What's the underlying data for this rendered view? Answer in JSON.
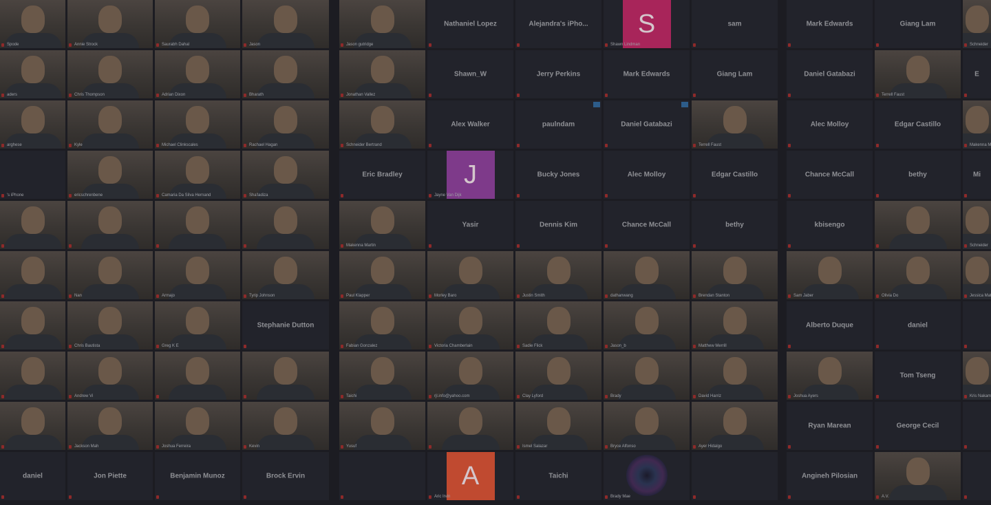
{
  "panels": [
    {
      "id": "left",
      "cols": 4,
      "tiles": [
        {
          "t": "video",
          "cap": "Spode"
        },
        {
          "t": "video",
          "cap": "Annie Strock"
        },
        {
          "t": "video",
          "cap": "Saurabh Dahal"
        },
        {
          "t": "video",
          "cap": "Jason"
        },
        {
          "t": "video",
          "cap": "aders"
        },
        {
          "t": "video",
          "cap": "Chris Thompson"
        },
        {
          "t": "video",
          "cap": "Adrian Dixon"
        },
        {
          "t": "video",
          "cap": "Bharath"
        },
        {
          "t": "video",
          "cap": "arghese"
        },
        {
          "t": "video",
          "cap": "Kyle"
        },
        {
          "t": "video",
          "cap": "Michael Clinkscales"
        },
        {
          "t": "video",
          "cap": "Rachael Hagan"
        },
        {
          "t": "name",
          "label": "",
          "cap": "'s iPhone"
        },
        {
          "t": "video",
          "cap": "ericschrenbene"
        },
        {
          "t": "video",
          "cap": "Camaria Da Silva Hernand"
        },
        {
          "t": "video",
          "cap": "Sha'ladiza"
        },
        {
          "t": "video",
          "cap": ""
        },
        {
          "t": "video",
          "cap": ""
        },
        {
          "t": "video",
          "cap": ""
        },
        {
          "t": "video",
          "cap": ""
        },
        {
          "t": "video",
          "cap": ""
        },
        {
          "t": "video",
          "cap": "Nan"
        },
        {
          "t": "video",
          "cap": "Armajo"
        },
        {
          "t": "video",
          "cap": "Tyrip Johnson"
        },
        {
          "t": "video",
          "cap": ""
        },
        {
          "t": "video",
          "cap": "Chris Bautista"
        },
        {
          "t": "video",
          "cap": "Greg K E"
        },
        {
          "t": "name",
          "label": "Stephanie Dutton",
          "cap": ""
        },
        {
          "t": "video",
          "cap": ""
        },
        {
          "t": "video",
          "cap": "Andrew Vi"
        },
        {
          "t": "video",
          "cap": ""
        },
        {
          "t": "video",
          "cap": ""
        },
        {
          "t": "video",
          "cap": ""
        },
        {
          "t": "video",
          "cap": "Jackson Mah"
        },
        {
          "t": "video",
          "cap": "Joshua Ferreira"
        },
        {
          "t": "video",
          "cap": "Kevin"
        },
        {
          "t": "name",
          "label": "daniel",
          "cap": ""
        },
        {
          "t": "name",
          "label": "Jon Piette",
          "cap": ""
        },
        {
          "t": "name",
          "label": "Benjamin Munoz",
          "cap": ""
        },
        {
          "t": "name",
          "label": "Brock Ervin",
          "cap": ""
        }
      ]
    },
    {
      "id": "middle",
      "cols": 5,
      "tiles": [
        {
          "t": "video",
          "cap": "Jason gutridge"
        },
        {
          "t": "name",
          "label": "Nathaniel Lopez",
          "cap": ""
        },
        {
          "t": "name",
          "label": "Alejandra's  iPho...",
          "cap": ""
        },
        {
          "t": "avatar",
          "letter": "S",
          "color": "#a8255a",
          "cap": "Shawn Lindman"
        },
        {
          "t": "name",
          "label": "sam",
          "cap": ""
        },
        {
          "t": "video",
          "cap": "Jonathan Vallez"
        },
        {
          "t": "name",
          "label": "Shawn_W",
          "cap": ""
        },
        {
          "t": "name",
          "label": "Jerry Perkins",
          "cap": ""
        },
        {
          "t": "name",
          "label": "Mark Edwards",
          "cap": ""
        },
        {
          "t": "name",
          "label": "Giang Lam",
          "cap": ""
        },
        {
          "t": "video",
          "cap": "Schneider Bertrand"
        },
        {
          "t": "name",
          "label": "Alex Walker",
          "cap": ""
        },
        {
          "t": "name",
          "label": "paulndam",
          "cap": "",
          "badge": true
        },
        {
          "t": "name",
          "label": "Daniel Gatabazi",
          "cap": "",
          "badge": true
        },
        {
          "t": "video",
          "cap": "Terrell Faust"
        },
        {
          "t": "name",
          "label": "Eric Bradley",
          "cap": ""
        },
        {
          "t": "avatar",
          "letter": "J",
          "color": "#7e3a8a",
          "cap": "Jayne Van Dijk"
        },
        {
          "t": "name",
          "label": "Bucky Jones",
          "cap": ""
        },
        {
          "t": "name",
          "label": "Alec Molloy",
          "cap": ""
        },
        {
          "t": "name",
          "label": "Edgar Castillo",
          "cap": ""
        },
        {
          "t": "video",
          "cap": "Makenna Martin"
        },
        {
          "t": "name",
          "label": "Yasir",
          "cap": ""
        },
        {
          "t": "name",
          "label": "Dennis Kim",
          "cap": ""
        },
        {
          "t": "name",
          "label": "Chance McCall",
          "cap": ""
        },
        {
          "t": "name",
          "label": "bethy",
          "cap": ""
        },
        {
          "t": "video",
          "cap": "Paul Klapper"
        },
        {
          "t": "video",
          "cap": "Morley Baro"
        },
        {
          "t": "video",
          "cap": "Justin Smith"
        },
        {
          "t": "video",
          "cap": "dathanwang"
        },
        {
          "t": "video",
          "cap": "Brendan Stanton"
        },
        {
          "t": "video",
          "cap": "Fabian Gonzalez"
        },
        {
          "t": "video",
          "cap": "Victoria Chamberlain"
        },
        {
          "t": "video",
          "cap": "Sadie Flick"
        },
        {
          "t": "video",
          "cap": "Jason_b"
        },
        {
          "t": "video",
          "cap": "Matthew Merrill"
        },
        {
          "t": "video",
          "cap": "Taichi"
        },
        {
          "t": "video",
          "cap": "rjl.info@yahoo.com"
        },
        {
          "t": "video",
          "cap": "Clay Lyford"
        },
        {
          "t": "video",
          "cap": "Brady"
        },
        {
          "t": "video",
          "cap": "David Harriz"
        },
        {
          "t": "video",
          "cap": "Yusuf"
        },
        {
          "t": "video",
          "cap": ""
        },
        {
          "t": "video",
          "cap": "Ismel Salazar"
        },
        {
          "t": "video",
          "cap": "Bryce Alfonso"
        },
        {
          "t": "video",
          "cap": "Ayer Hidalgo"
        },
        {
          "t": "name",
          "label": "",
          "cap": ""
        },
        {
          "t": "avatar",
          "letter": "A",
          "color": "#c04a30",
          "cap": "Aric Irvin"
        },
        {
          "t": "name",
          "label": "Taichi",
          "cap": ""
        },
        {
          "t": "spiral",
          "cap": "Brady Mae"
        },
        {
          "t": "name",
          "label": "",
          "cap": ""
        }
      ]
    },
    {
      "id": "right",
      "cols": 3,
      "tiles": [
        {
          "t": "name",
          "label": "Mark Edwards",
          "cap": ""
        },
        {
          "t": "name",
          "label": "Giang Lam",
          "cap": ""
        },
        {
          "t": "video",
          "cap": "Schneider"
        },
        {
          "t": "name",
          "label": "Daniel Gatabazi",
          "cap": ""
        },
        {
          "t": "video",
          "cap": "Terrell Faust"
        },
        {
          "t": "name",
          "label": "E",
          "cap": ""
        },
        {
          "t": "name",
          "label": "Alec Molloy",
          "cap": ""
        },
        {
          "t": "name",
          "label": "Edgar Castillo",
          "cap": ""
        },
        {
          "t": "video",
          "cap": "Makenna M"
        },
        {
          "t": "name",
          "label": "Chance McCall",
          "cap": ""
        },
        {
          "t": "name",
          "label": "bethy",
          "cap": ""
        },
        {
          "t": "name",
          "label": "Mi",
          "cap": ""
        },
        {
          "t": "name",
          "label": "kbisengo",
          "cap": ""
        },
        {
          "t": "video",
          "cap": ""
        },
        {
          "t": "video",
          "cap": "Schneider"
        },
        {
          "t": "video",
          "cap": "Sam Jaber"
        },
        {
          "t": "video",
          "cap": "Olivia Do"
        },
        {
          "t": "video",
          "cap": "Jessica Mattison"
        },
        {
          "t": "name",
          "label": "Alberto Duque",
          "cap": ""
        },
        {
          "t": "name",
          "label": "daniel",
          "cap": ""
        },
        {
          "t": "name",
          "label": "",
          "cap": ""
        },
        {
          "t": "video",
          "cap": "Joshua Ayers"
        },
        {
          "t": "name",
          "label": "Tom Tseng",
          "cap": ""
        },
        {
          "t": "video",
          "cap": "Kris Nakamura"
        },
        {
          "t": "name",
          "label": "Ryan Marean",
          "cap": ""
        },
        {
          "t": "name",
          "label": "George Cecil",
          "cap": ""
        },
        {
          "t": "name",
          "label": "",
          "cap": ""
        },
        {
          "t": "name",
          "label": "Angineh Pilosian",
          "cap": ""
        },
        {
          "t": "video",
          "cap": "A.V."
        },
        {
          "t": "name",
          "label": "",
          "cap": ""
        }
      ]
    }
  ]
}
